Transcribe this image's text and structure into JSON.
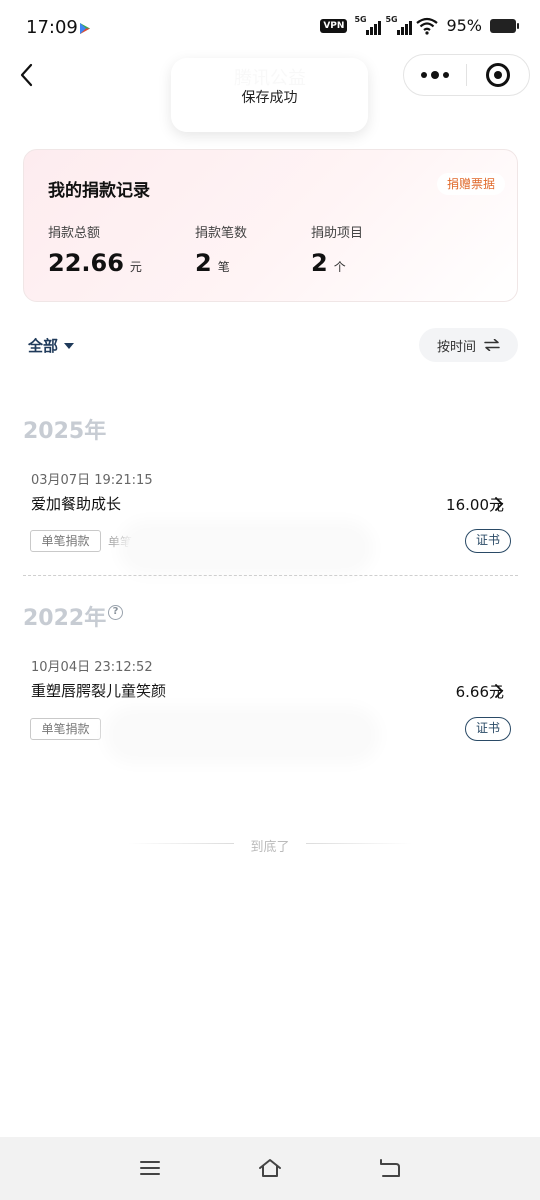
{
  "status_bar": {
    "time": "17:09",
    "vpn": "VPN",
    "signal_1": "5G",
    "signal_2": "5G",
    "battery": "95%"
  },
  "nav": {
    "title": "腾讯公益"
  },
  "toast": {
    "text": "保存成功"
  },
  "summary": {
    "title": "我的捐款记录",
    "receipt_button": "捐赠票据",
    "stats": [
      {
        "label": "捐款总额",
        "value": "22.66",
        "unit": "元"
      },
      {
        "label": "捐款笔数",
        "value": "2",
        "unit": "笔"
      },
      {
        "label": "捐助项目",
        "value": "2",
        "unit": "个"
      }
    ]
  },
  "filter": {
    "all_label": "全部",
    "sort_label": "按时间"
  },
  "groups": [
    {
      "year": "2025年",
      "records": [
        {
          "date": "03月07日 19:21:15",
          "name": "爱加餐助成长",
          "amount": "16.00元",
          "tag": "单笔捐款",
          "tag_extra": "单笔",
          "cert": "证书"
        }
      ]
    },
    {
      "year": "2022年",
      "records": [
        {
          "date": "10月04日 23:12:52",
          "name": "重塑唇腭裂儿童笑颜",
          "amount": "6.66元",
          "tag": "单笔捐款",
          "cert": "证书"
        }
      ]
    }
  ],
  "footer": {
    "end_text": "到底了"
  },
  "icons": {
    "back": "chevron-left-icon",
    "more": "more-dots-icon",
    "close": "target-close-icon",
    "sort": "swap-arrows-icon",
    "help": "question-circle-icon"
  }
}
